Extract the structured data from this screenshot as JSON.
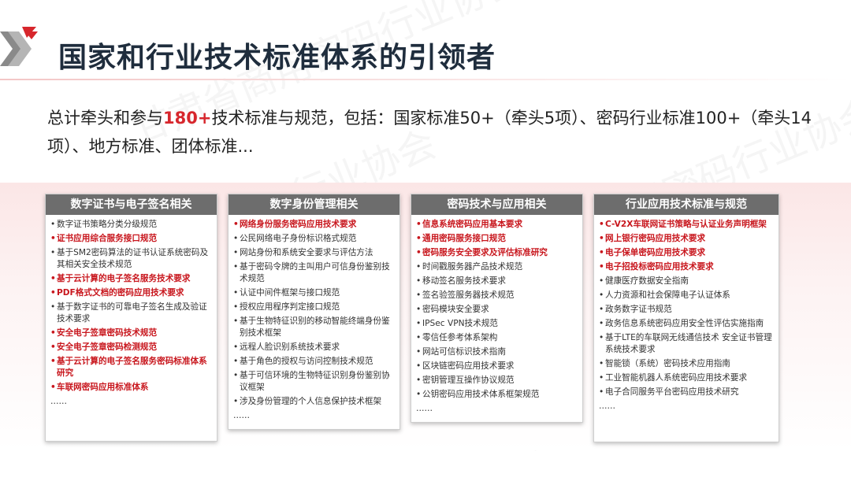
{
  "title": "国家和行业技术标准体系的引领者",
  "summary": {
    "prefix": "总计牵头和参与",
    "highlight": "180+",
    "rest": "技术标准与规范，包括：国家标准50+（牵头5项）、密码行业标准100+（牵头14项）、地方标准、团体标准..."
  },
  "watermark": "甘肃省商用密码行业协会",
  "colors": {
    "accent": "#d7262c",
    "header_bg": "#6d6d6d",
    "item_red": "#c8161d"
  },
  "columns": [
    {
      "header": "数字证书与电子签名相关",
      "items": [
        {
          "text": "数字证书策略分类分级规范",
          "red": false
        },
        {
          "text": "证书应用综合服务接口规范",
          "red": true
        },
        {
          "text": "基于SM2密码算法的证书认证系统密码及其相关安全技术规范",
          "red": false
        },
        {
          "text": "基于云计算的电子签名服务技术要求",
          "red": true
        },
        {
          "text": "PDF格式文档的密码应用技术要求",
          "red": true
        },
        {
          "text": "基于数字证书的可靠电子签名生成及验证技术要求",
          "red": false
        },
        {
          "text": "安全电子签章密码技术规范",
          "red": true
        },
        {
          "text": "安全电子签章密码检测规范",
          "red": true
        },
        {
          "text": "基于云计算的电子签名服务密码标准体系研究",
          "red": true
        },
        {
          "text": "车联网密码应用标准体系",
          "red": true
        }
      ],
      "more": "......"
    },
    {
      "header": "数字身份管理相关",
      "items": [
        {
          "text": "网络身份服务密码应用技术要求",
          "red": true
        },
        {
          "text": "公民网络电子身份标识格式规范",
          "red": false
        },
        {
          "text": "网站身份和系统安全要求与评估方法",
          "red": false
        },
        {
          "text": "基于密码令牌的主叫用户可信身份鉴别技术规范",
          "red": false
        },
        {
          "text": "认证中间件框架与接口规范",
          "red": false
        },
        {
          "text": "授权应用程序判定接口规范",
          "red": false
        },
        {
          "text": "基于生物特征识别的移动智能终端身份鉴别技术框架",
          "red": false
        },
        {
          "text": "远程人脸识别系统技术要求",
          "red": false
        },
        {
          "text": "基于角色的授权与访问控制技术规范",
          "red": false
        },
        {
          "text": "基于可信环境的生物特征识别身份鉴别协议框架",
          "red": false
        },
        {
          "text": "涉及身份管理的个人信息保护技术框架",
          "red": false
        }
      ],
      "more": "......"
    },
    {
      "header": "密码技术与应用相关",
      "items": [
        {
          "text": "信息系统密码应用基本要求",
          "red": true
        },
        {
          "text": "通用密码服务接口规范",
          "red": true
        },
        {
          "text": "密码服务安全要求及评估标准研究",
          "red": true
        },
        {
          "text": "时间戳服务器产品技术规范",
          "red": false
        },
        {
          "text": "移动签名服务技术要求",
          "red": false
        },
        {
          "text": "签名验签服务器技术规范",
          "red": false
        },
        {
          "text": "密码模块安全要求",
          "red": false
        },
        {
          "text": "IPSec VPN技术规范",
          "red": false
        },
        {
          "text": "零信任参考体系架构",
          "red": false
        },
        {
          "text": "网站可信标识技术指南",
          "red": false
        },
        {
          "text": "区块链密码应用技术要求",
          "red": false
        },
        {
          "text": "密钥管理互操作协议规范",
          "red": false
        },
        {
          "text": "公钥密码应用技术体系框架规范",
          "red": false
        }
      ],
      "more": "......"
    },
    {
      "header": "行业应用技术标准与规范",
      "items": [
        {
          "text": "C-V2X车联网证书策略与认证业务声明框架",
          "red": true
        },
        {
          "text": "网上银行密码应用技术要求",
          "red": true
        },
        {
          "text": "电子保单密码应用技术要求",
          "red": true
        },
        {
          "text": "电子招投标密码应用技术要求",
          "red": true
        },
        {
          "text": "健康医疗数据安全指南",
          "red": false
        },
        {
          "text": "人力资源和社会保障电子认证体系",
          "red": false
        },
        {
          "text": "政务数字证书规范",
          "red": false
        },
        {
          "text": "政务信息系统密码应用安全性评估实施指南",
          "red": false
        },
        {
          "text": "基于LTE的车联网无线通信技术 安全证书管理系统技术要求",
          "red": false
        },
        {
          "text": "智能锁（系统）密码技术应用指南",
          "red": false
        },
        {
          "text": "工业智能机器人系统密码应用技术要求",
          "red": false
        },
        {
          "text": "电子合同服务平台密码应用技术研究",
          "red": false
        }
      ],
      "more": "......"
    }
  ]
}
